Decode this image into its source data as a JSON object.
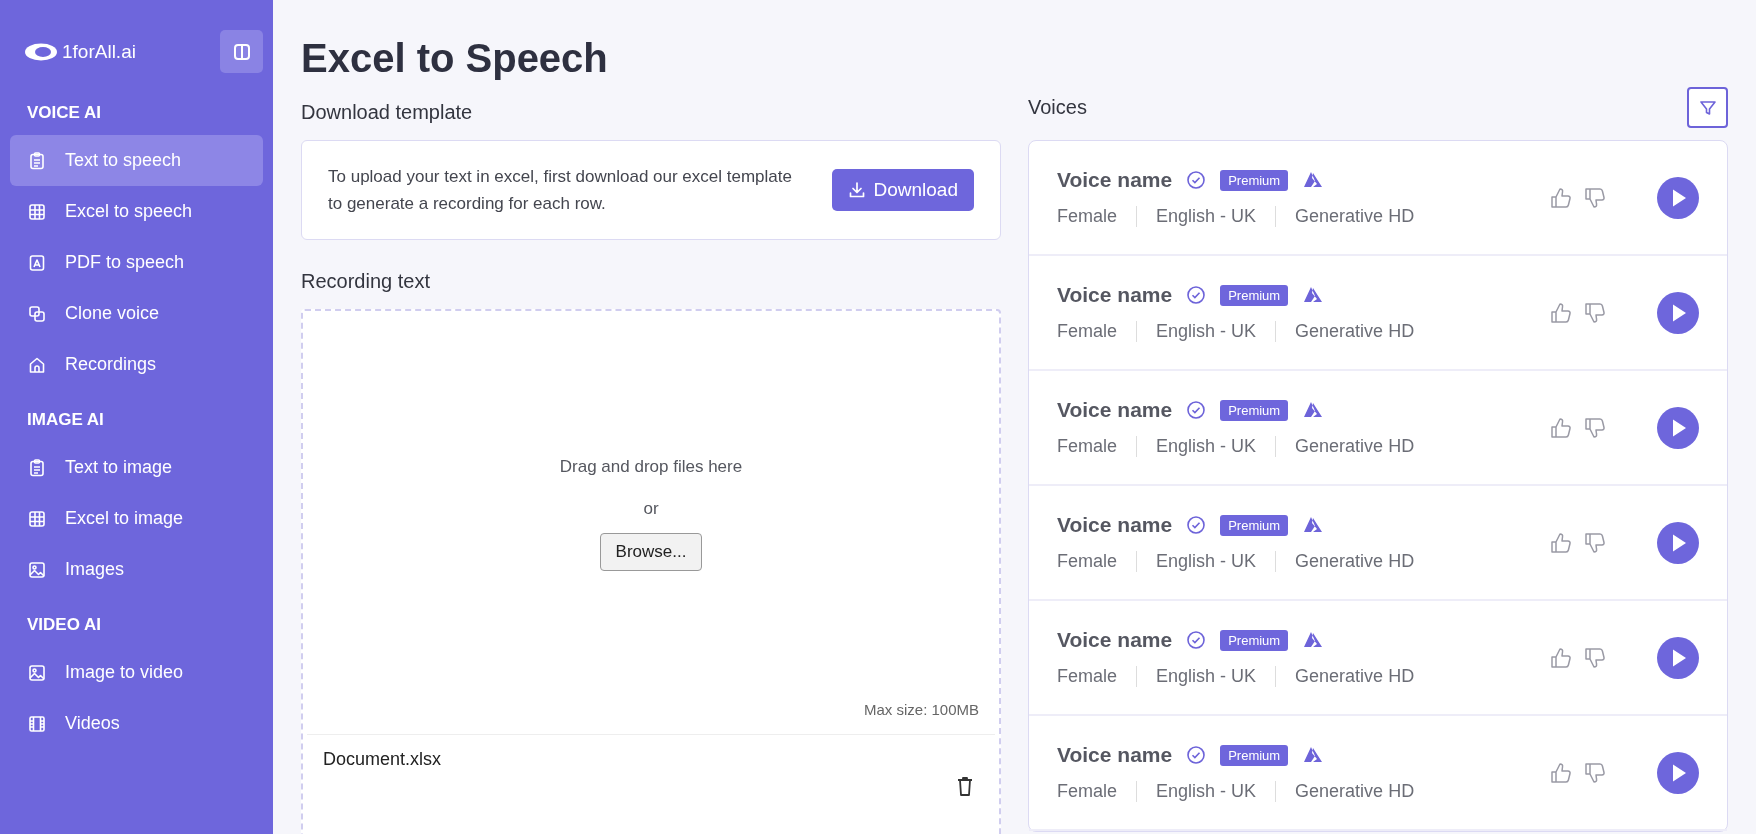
{
  "sidebar": {
    "logo": "1forAll.ai",
    "sections": [
      {
        "title": "VOICE AI",
        "items": [
          {
            "label": "Text to speech",
            "kind": "document",
            "selected": true
          },
          {
            "label": "Excel to speech",
            "kind": "table",
            "selected": false
          },
          {
            "label": "PDF to speech",
            "kind": "pdf",
            "selected": false
          },
          {
            "label": "Clone voice",
            "kind": "clone",
            "selected": false
          },
          {
            "label": "Recordings",
            "kind": "home",
            "selected": false
          }
        ]
      },
      {
        "title": "IMAGE AI",
        "items": [
          {
            "label": "Text to image",
            "kind": "document",
            "selected": false
          },
          {
            "label": "Excel to image",
            "kind": "table",
            "selected": false
          },
          {
            "label": "Images",
            "kind": "image",
            "selected": false
          }
        ]
      },
      {
        "title": "VIDEO AI",
        "items": [
          {
            "label": "Image to video",
            "kind": "image",
            "selected": false
          },
          {
            "label": "Videos",
            "kind": "film",
            "selected": false
          }
        ]
      }
    ]
  },
  "page_title": "Excel to Speech",
  "download_template": {
    "heading": "Download template",
    "text": "To upload your text in excel, first download our excel template to generate a recording for each row.",
    "button": "Download"
  },
  "recording_text": {
    "heading": "Recording text",
    "drop_hint": "Drag and drop files here",
    "or": "or",
    "browse": "Browse...",
    "max_size": "Max size: 100MB",
    "file": {
      "name": "Document.xlsx"
    }
  },
  "voices": {
    "heading": "Voices",
    "items": [
      {
        "name": "Voice name",
        "badge": "Premium",
        "tags": [
          "Female",
          "English - UK",
          "Generative HD"
        ]
      },
      {
        "name": "Voice name",
        "badge": "Premium",
        "tags": [
          "Female",
          "English - UK",
          "Generative HD"
        ]
      },
      {
        "name": "Voice name",
        "badge": "Premium",
        "tags": [
          "Female",
          "English - UK",
          "Generative HD"
        ]
      },
      {
        "name": "Voice name",
        "badge": "Premium",
        "tags": [
          "Female",
          "English - UK",
          "Generative HD"
        ]
      },
      {
        "name": "Voice name",
        "badge": "Premium",
        "tags": [
          "Female",
          "English - UK",
          "Generative HD"
        ]
      },
      {
        "name": "Voice name",
        "badge": "Premium",
        "tags": [
          "Female",
          "English - UK",
          "Generative HD"
        ]
      }
    ]
  }
}
